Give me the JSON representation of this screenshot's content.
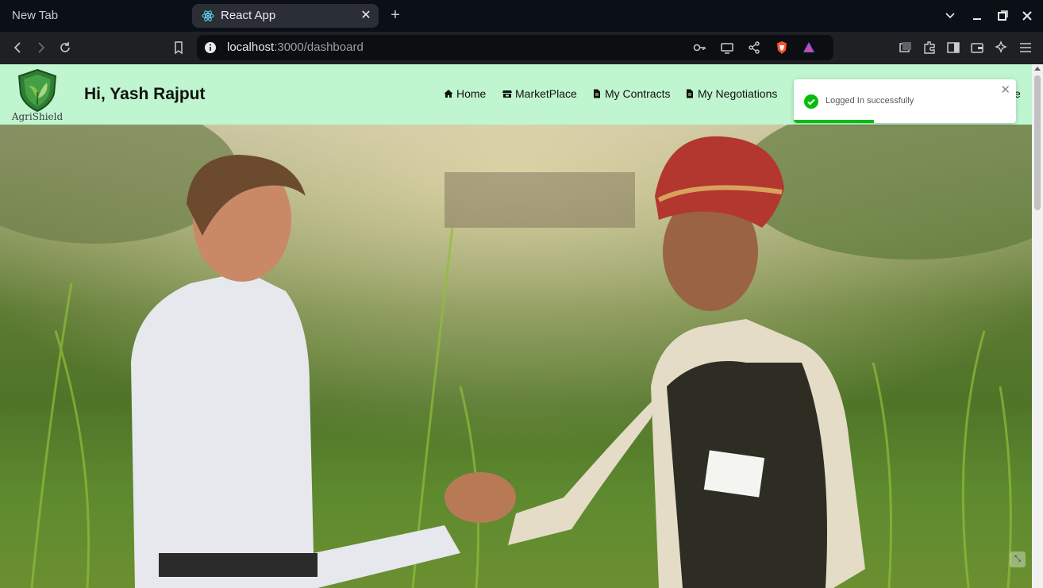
{
  "browser": {
    "tabs": [
      {
        "title": "New Tab",
        "active": false
      },
      {
        "title": "React App",
        "active": true
      }
    ],
    "url": {
      "host": "localhost",
      "path": ":3000/dashboard"
    },
    "colors": {
      "tabbar": "#0b0f16",
      "toolbar": "#1f2023",
      "active_tab": "#2b2e35"
    }
  },
  "header": {
    "logo_text": "AgriShield",
    "greeting": "Hi, Yash Rajput",
    "nav": [
      {
        "label": "Home",
        "icon": "home-icon"
      },
      {
        "label": "MarketPlace",
        "icon": "store-icon"
      },
      {
        "label": "My Contracts",
        "icon": "file-icon"
      },
      {
        "label": "My Negotiations",
        "icon": "file-icon"
      }
    ],
    "nav_trailing_partial": "e",
    "background": "#bff5cf"
  },
  "toast": {
    "message": "Logged In successfully",
    "status": "success",
    "progress": 0.36,
    "accent": "#07bc0c"
  },
  "hero": {
    "image": "farmer-handshake-photo"
  }
}
